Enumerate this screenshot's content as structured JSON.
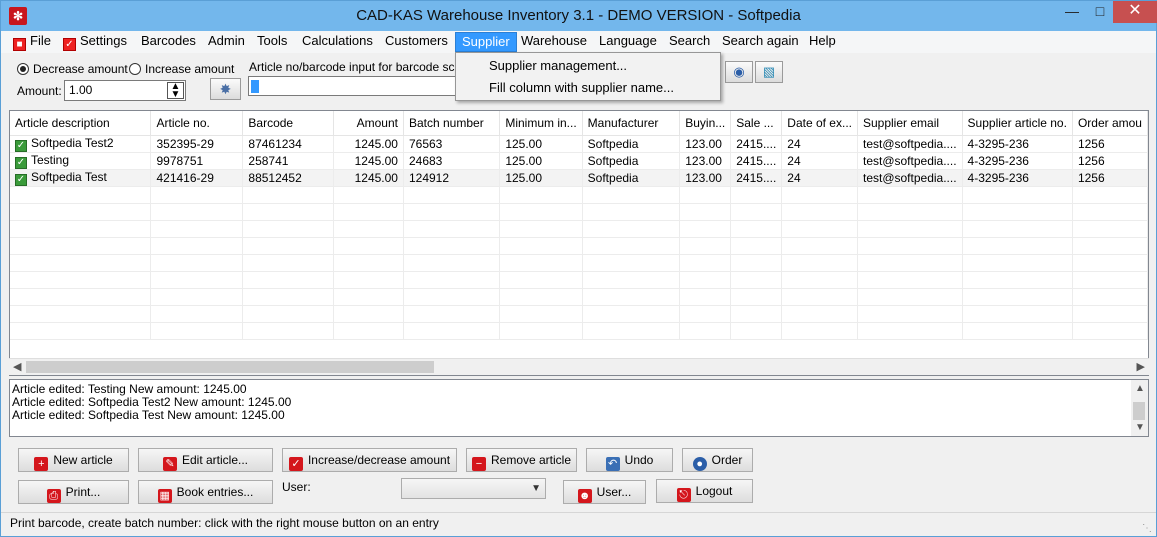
{
  "window": {
    "title": "CAD-KAS Warehouse Inventory 3.1 - DEMO VERSION - Softpedia"
  },
  "menu": [
    {
      "label": "File",
      "icon": "floppy-icon"
    },
    {
      "label": "Settings",
      "icon": "checkbox-icon"
    },
    {
      "label": "Barcodes"
    },
    {
      "label": "Admin"
    },
    {
      "label": "Tools"
    },
    {
      "label": "Calculations"
    },
    {
      "label": "Customers"
    },
    {
      "label": "Supplier",
      "active": true
    },
    {
      "label": "Warehouse"
    },
    {
      "label": "Language"
    },
    {
      "label": "Search"
    },
    {
      "label": "Search again"
    },
    {
      "label": "Help"
    }
  ],
  "supplier_menu": {
    "items": [
      "Supplier management...",
      "Fill column with supplier name..."
    ]
  },
  "toolbar": {
    "decrease_label": "Decrease amount",
    "increase_label": "Increase amount",
    "amount_label": "Amount:",
    "amount_value": "1.00",
    "barcode_label": "Article no/barcode input for barcode scanne",
    "barcode_value": "C"
  },
  "grid": {
    "columns": [
      "Article description",
      "Article no.",
      "Barcode",
      "Amount",
      "Batch number",
      "Minimum in...",
      "Manufacturer",
      "Buyin...",
      "Sale ...",
      "Date of ex...",
      "Supplier email",
      "Supplier article no.",
      "Order amou"
    ],
    "rows": [
      [
        "Softpedia Test2",
        "352395-29",
        "87461234",
        "1245.00",
        "76563",
        "125.00",
        "Softpedia",
        "123.00",
        "2415....",
        "24",
        "test@softpedia....",
        "4-3295-236",
        "1256"
      ],
      [
        "Testing",
        "9978751",
        "258741",
        "1245.00",
        "24683",
        "125.00",
        "Softpedia",
        "123.00",
        "2415....",
        "24",
        "test@softpedia....",
        "4-3295-236",
        "1256"
      ],
      [
        "Softpedia Test",
        "421416-29",
        "88512452",
        "1245.00",
        "124912",
        "125.00",
        "Softpedia",
        "123.00",
        "2415....",
        "24",
        "test@softpedia....",
        "4-3295-236",
        "1256"
      ]
    ]
  },
  "log": [
    "Article edited: Testing New amount: 1245.00",
    "Article edited: Softpedia Test2 New amount: 1245.00",
    "Article edited: Softpedia Test New amount: 1245.00"
  ],
  "buttons": {
    "new_article": "New article",
    "edit_article": "Edit article...",
    "inc_dec": "Increase/decrease amount",
    "remove_article": "Remove article",
    "undo": "Undo",
    "order": "Order",
    "print": "Print...",
    "book_entries": "Book entries...",
    "user_label": "User:",
    "user_btn": "User...",
    "logout": "Logout"
  },
  "status": {
    "text": "Print barcode, create batch number: click with the right mouse button on an entry"
  }
}
